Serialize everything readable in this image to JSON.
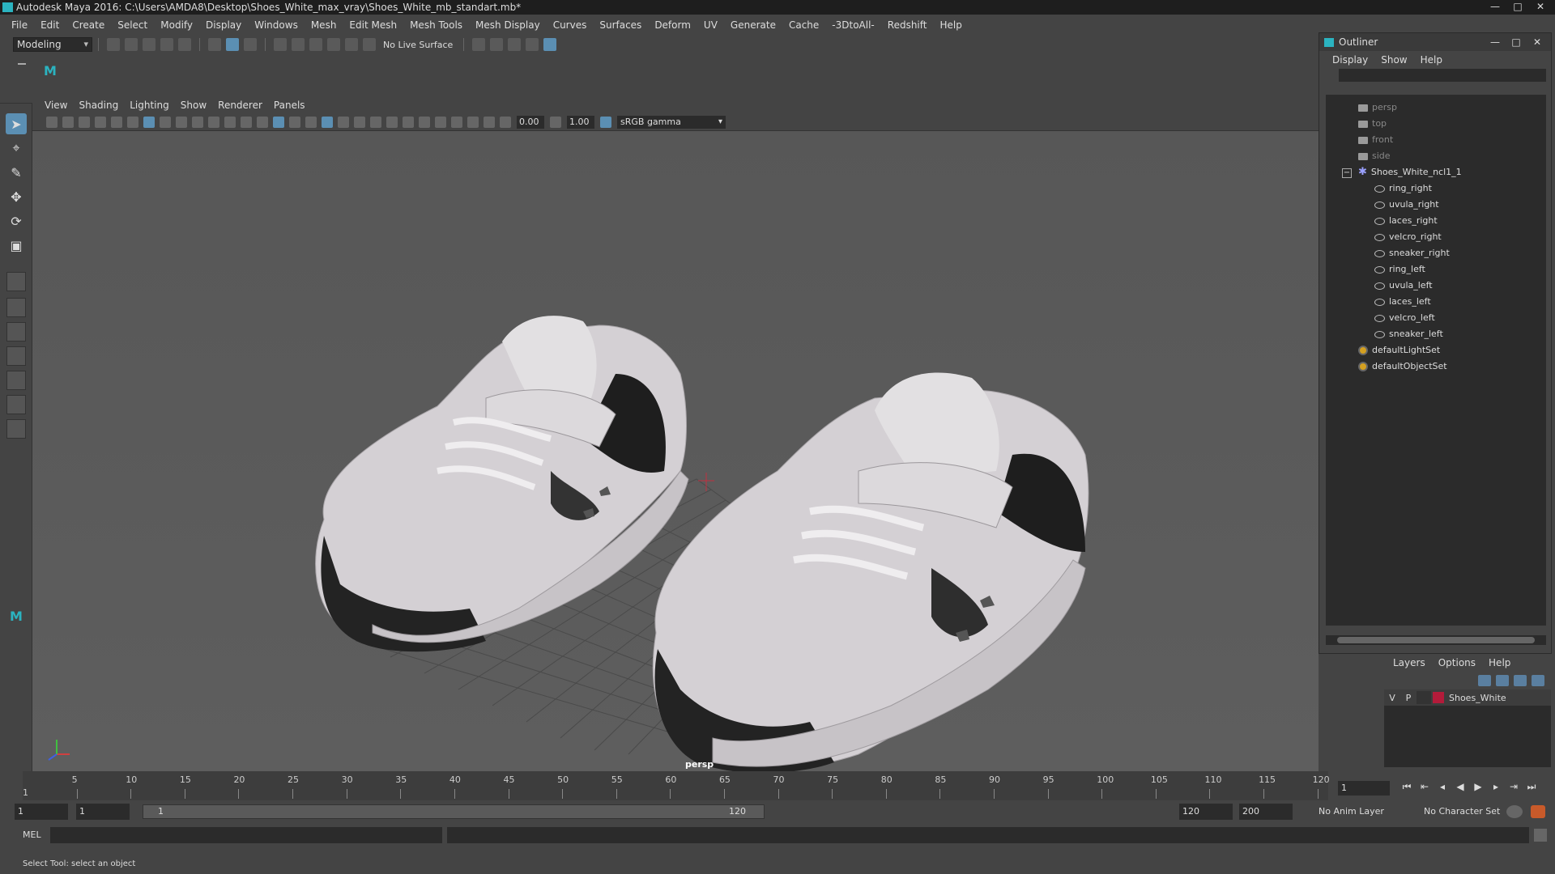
{
  "window": {
    "title": "Autodesk Maya 2016: C:\\Users\\AMDA8\\Desktop\\Shoes_White_max_vray\\Shoes_White_mb_standart.mb*",
    "minimize": "—",
    "maximize": "□",
    "close": "✕"
  },
  "menubar": [
    "File",
    "Edit",
    "Create",
    "Select",
    "Modify",
    "Display",
    "Windows",
    "Mesh",
    "Edit Mesh",
    "Mesh Tools",
    "Mesh Display",
    "Curves",
    "Surfaces",
    "Deform",
    "UV",
    "Generate",
    "Cache",
    "-3DtoAll-",
    "Redshift",
    "Help"
  ],
  "statusline": {
    "mode": "Modeling",
    "live_surface": "No Live Surface"
  },
  "viewport": {
    "menu": [
      "View",
      "Shading",
      "Lighting",
      "Show",
      "Renderer",
      "Panels"
    ],
    "exposure": "0.00",
    "gamma": "1.00",
    "color_space": "sRGB gamma",
    "camera_label": "persp"
  },
  "outliner": {
    "title": "Outliner",
    "menu": [
      "Display",
      "Show",
      "Help"
    ],
    "cameras": [
      "persp",
      "top",
      "front",
      "side"
    ],
    "group": "Shoes_White_ncl1_1",
    "children": [
      "ring_right",
      "uvula_right",
      "laces_right",
      "velcro_right",
      "sneaker_right",
      "ring_left",
      "uvula_left",
      "laces_left",
      "velcro_left",
      "sneaker_left"
    ],
    "sets": [
      "defaultLightSet",
      "defaultObjectSet"
    ]
  },
  "layers": {
    "menu": [
      "Layers",
      "Options",
      "Help"
    ],
    "rows": [
      {
        "v": "V",
        "p": "P",
        "name": "Shoes_White",
        "color": "#b31b3a"
      }
    ]
  },
  "timeslider": {
    "ticks": [
      "5",
      "10",
      "15",
      "20",
      "25",
      "30",
      "35",
      "40",
      "45",
      "50",
      "55",
      "60",
      "65",
      "70",
      "75",
      "80",
      "85",
      "90",
      "95",
      "100",
      "105",
      "110",
      "115",
      "120"
    ],
    "start_label": "1",
    "current_frame": "1"
  },
  "rangeslider": {
    "start": "1",
    "playback_start": "1",
    "bar_start": "1",
    "bar_end": "120",
    "playback_end": "120",
    "end": "200",
    "anim_layer": "No Anim Layer",
    "character_set": "No Character Set"
  },
  "cmdline": {
    "label": "MEL"
  },
  "helpline": {
    "text": "Select Tool: select an object"
  }
}
